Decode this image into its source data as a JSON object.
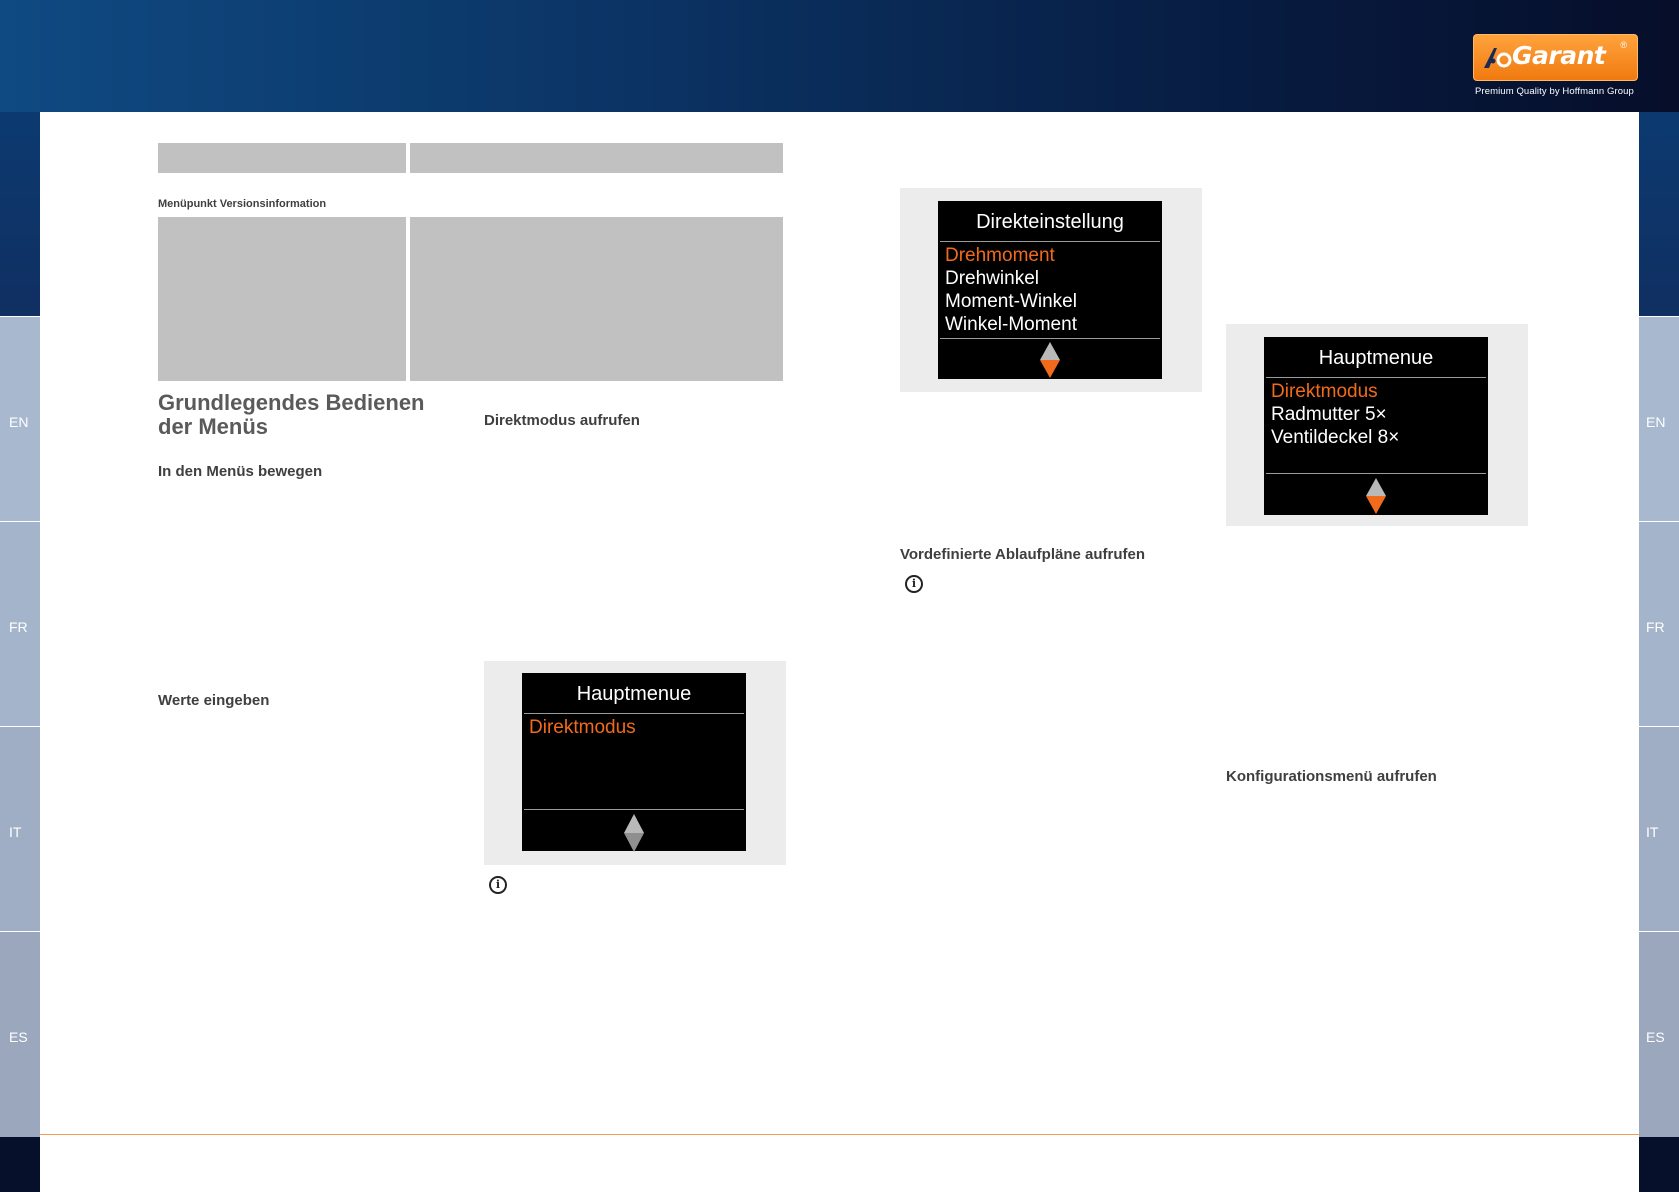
{
  "brand": {
    "logo_text": "Garant",
    "registered": "®",
    "tagline": "Premium Quality by Hoffmann Group",
    "accent_orange": "#f26a1b",
    "header_blue": "#0b3262"
  },
  "language_tabs": [
    "EN",
    "FR",
    "IT",
    "ES"
  ],
  "left_column": {
    "version_label": "Menüpunkt Versionsinformation",
    "heading_line1": "Grundlegendes Bedienen",
    "heading_line2": "der Menüs",
    "sub1": "In den Menüs bewegen",
    "sub2": "Werte eingeben"
  },
  "middle_column": {
    "sub1": "Direktmodus aufrufen",
    "screen": {
      "title": "Hauptmenue",
      "items": [
        "Direktmodus"
      ]
    }
  },
  "right_column": {
    "screen_direct": {
      "title": "Direkteinstellung",
      "items": [
        "Drehmoment",
        "Drehwinkel",
        "Moment-Winkel",
        "Winkel-Moment"
      ]
    },
    "sub1": "Vordefinierte Ablaufpläne aufrufen",
    "screen_main": {
      "title": "Hauptmenue",
      "items": [
        "Direktmodus",
        "Radmutter 5×",
        "Ventildeckel 8×"
      ]
    },
    "sub2": "Konfigurationsmenü aufrufen"
  },
  "icons": {
    "info": "info-circle-icon",
    "scroll": "up-down-arrow-icon"
  }
}
